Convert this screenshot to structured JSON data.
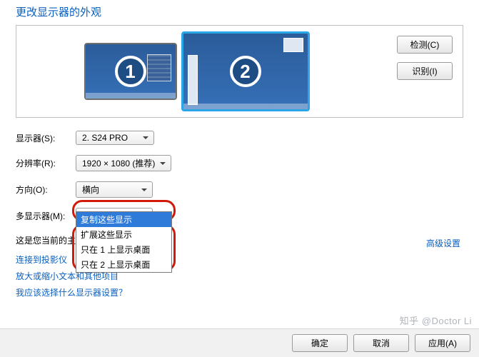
{
  "title": "更改显示器的外观",
  "preview": {
    "detect_label": "检测(C)",
    "identify_label": "识别(I)",
    "monitor1_num": "1",
    "monitor2_num": "2"
  },
  "form": {
    "display_label": "显示器(S):",
    "display_value": "2. S24 PRO",
    "resolution_label": "分辨率(R):",
    "resolution_value": "1920 × 1080 (推荐)",
    "orientation_label": "方向(O):",
    "orientation_value": "横向",
    "multi_label": "多显示器(M):",
    "multi_value": "扩展这些显示",
    "multi_options": [
      "复制这些显示",
      "扩展这些显示",
      "只在 1 上显示桌面",
      "只在 2 上显示桌面"
    ]
  },
  "primary_text": "这是您当前的主",
  "links": {
    "projector": "连接到投影仪",
    "textsize": "放大或缩小文本和其他项目",
    "which": "我应该选择什么显示器设置？",
    "advanced": "高级设置"
  },
  "buttons": {
    "ok": "确定",
    "cancel": "取消",
    "apply": "应用(A)"
  },
  "watermark": "知乎 @Doctor Li"
}
